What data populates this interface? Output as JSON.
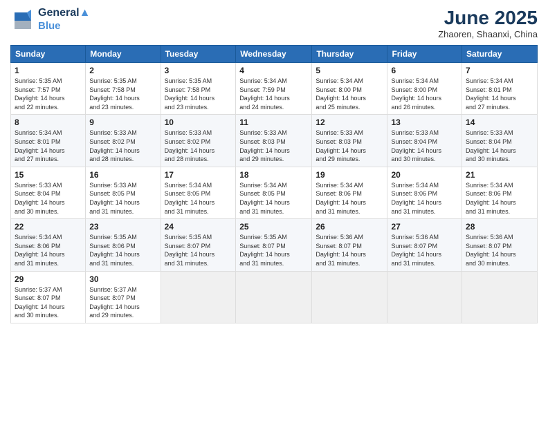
{
  "logo": {
    "line1": "General",
    "line2": "Blue"
  },
  "title": "June 2025",
  "location": "Zhaoren, Shaanxi, China",
  "days_header": [
    "Sunday",
    "Monday",
    "Tuesday",
    "Wednesday",
    "Thursday",
    "Friday",
    "Saturday"
  ],
  "weeks": [
    [
      {
        "day": "1",
        "info": "Sunrise: 5:35 AM\nSunset: 7:57 PM\nDaylight: 14 hours\nand 22 minutes."
      },
      {
        "day": "2",
        "info": "Sunrise: 5:35 AM\nSunset: 7:58 PM\nDaylight: 14 hours\nand 23 minutes."
      },
      {
        "day": "3",
        "info": "Sunrise: 5:35 AM\nSunset: 7:58 PM\nDaylight: 14 hours\nand 23 minutes."
      },
      {
        "day": "4",
        "info": "Sunrise: 5:34 AM\nSunset: 7:59 PM\nDaylight: 14 hours\nand 24 minutes."
      },
      {
        "day": "5",
        "info": "Sunrise: 5:34 AM\nSunset: 8:00 PM\nDaylight: 14 hours\nand 25 minutes."
      },
      {
        "day": "6",
        "info": "Sunrise: 5:34 AM\nSunset: 8:00 PM\nDaylight: 14 hours\nand 26 minutes."
      },
      {
        "day": "7",
        "info": "Sunrise: 5:34 AM\nSunset: 8:01 PM\nDaylight: 14 hours\nand 27 minutes."
      }
    ],
    [
      {
        "day": "8",
        "info": "Sunrise: 5:34 AM\nSunset: 8:01 PM\nDaylight: 14 hours\nand 27 minutes."
      },
      {
        "day": "9",
        "info": "Sunrise: 5:33 AM\nSunset: 8:02 PM\nDaylight: 14 hours\nand 28 minutes."
      },
      {
        "day": "10",
        "info": "Sunrise: 5:33 AM\nSunset: 8:02 PM\nDaylight: 14 hours\nand 28 minutes."
      },
      {
        "day": "11",
        "info": "Sunrise: 5:33 AM\nSunset: 8:03 PM\nDaylight: 14 hours\nand 29 minutes."
      },
      {
        "day": "12",
        "info": "Sunrise: 5:33 AM\nSunset: 8:03 PM\nDaylight: 14 hours\nand 29 minutes."
      },
      {
        "day": "13",
        "info": "Sunrise: 5:33 AM\nSunset: 8:04 PM\nDaylight: 14 hours\nand 30 minutes."
      },
      {
        "day": "14",
        "info": "Sunrise: 5:33 AM\nSunset: 8:04 PM\nDaylight: 14 hours\nand 30 minutes."
      }
    ],
    [
      {
        "day": "15",
        "info": "Sunrise: 5:33 AM\nSunset: 8:04 PM\nDaylight: 14 hours\nand 30 minutes."
      },
      {
        "day": "16",
        "info": "Sunrise: 5:33 AM\nSunset: 8:05 PM\nDaylight: 14 hours\nand 31 minutes."
      },
      {
        "day": "17",
        "info": "Sunrise: 5:34 AM\nSunset: 8:05 PM\nDaylight: 14 hours\nand 31 minutes."
      },
      {
        "day": "18",
        "info": "Sunrise: 5:34 AM\nSunset: 8:05 PM\nDaylight: 14 hours\nand 31 minutes."
      },
      {
        "day": "19",
        "info": "Sunrise: 5:34 AM\nSunset: 8:06 PM\nDaylight: 14 hours\nand 31 minutes."
      },
      {
        "day": "20",
        "info": "Sunrise: 5:34 AM\nSunset: 8:06 PM\nDaylight: 14 hours\nand 31 minutes."
      },
      {
        "day": "21",
        "info": "Sunrise: 5:34 AM\nSunset: 8:06 PM\nDaylight: 14 hours\nand 31 minutes."
      }
    ],
    [
      {
        "day": "22",
        "info": "Sunrise: 5:34 AM\nSunset: 8:06 PM\nDaylight: 14 hours\nand 31 minutes."
      },
      {
        "day": "23",
        "info": "Sunrise: 5:35 AM\nSunset: 8:06 PM\nDaylight: 14 hours\nand 31 minutes."
      },
      {
        "day": "24",
        "info": "Sunrise: 5:35 AM\nSunset: 8:07 PM\nDaylight: 14 hours\nand 31 minutes."
      },
      {
        "day": "25",
        "info": "Sunrise: 5:35 AM\nSunset: 8:07 PM\nDaylight: 14 hours\nand 31 minutes."
      },
      {
        "day": "26",
        "info": "Sunrise: 5:36 AM\nSunset: 8:07 PM\nDaylight: 14 hours\nand 31 minutes."
      },
      {
        "day": "27",
        "info": "Sunrise: 5:36 AM\nSunset: 8:07 PM\nDaylight: 14 hours\nand 31 minutes."
      },
      {
        "day": "28",
        "info": "Sunrise: 5:36 AM\nSunset: 8:07 PM\nDaylight: 14 hours\nand 30 minutes."
      }
    ],
    [
      {
        "day": "29",
        "info": "Sunrise: 5:37 AM\nSunset: 8:07 PM\nDaylight: 14 hours\nand 30 minutes."
      },
      {
        "day": "30",
        "info": "Sunrise: 5:37 AM\nSunset: 8:07 PM\nDaylight: 14 hours\nand 29 minutes."
      },
      {
        "day": "",
        "info": ""
      },
      {
        "day": "",
        "info": ""
      },
      {
        "day": "",
        "info": ""
      },
      {
        "day": "",
        "info": ""
      },
      {
        "day": "",
        "info": ""
      }
    ]
  ]
}
